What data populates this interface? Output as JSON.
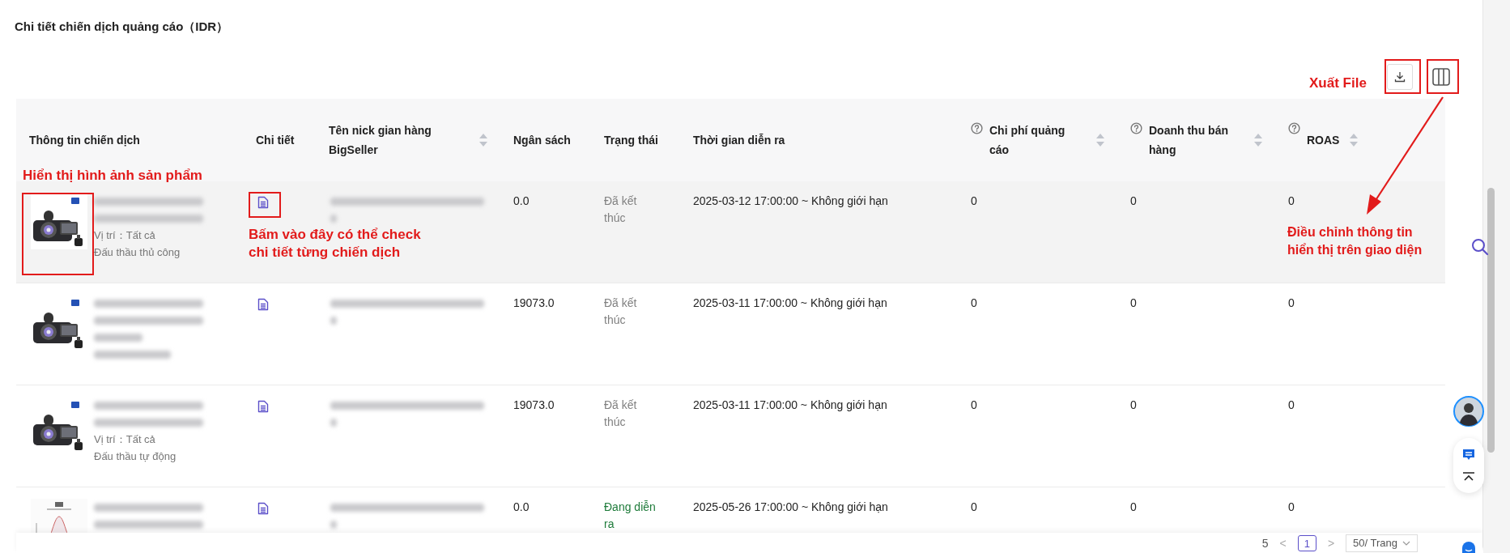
{
  "title": "Chi tiết chiến dịch quảng cáo（IDR）",
  "columns": [
    {
      "label": "Thông tin chiến dịch",
      "sortable": false,
      "help": false
    },
    {
      "label": "Chi tiết",
      "sortable": false,
      "help": false
    },
    {
      "label": "Tên nick gian hàng BigSeller",
      "sortable": true,
      "help": false
    },
    {
      "label": "Ngân sách",
      "sortable": false,
      "help": false
    },
    {
      "label": "Trạng thái",
      "sortable": false,
      "help": false
    },
    {
      "label": "Thời gian diễn ra",
      "sortable": false,
      "help": false
    },
    {
      "label": "Chi phí quảng cáo",
      "sortable": true,
      "help": true
    },
    {
      "label": "Doanh thu bán hàng",
      "sortable": true,
      "help": true
    },
    {
      "label": "ROAS",
      "sortable": true,
      "help": true
    }
  ],
  "rows": [
    {
      "highlighted": true,
      "campaign_lines": [
        {
          "kind": "blurred"
        },
        {
          "kind": "blurred"
        },
        {
          "kind": "text",
          "text": "Vị trí：Tất cả"
        },
        {
          "kind": "text",
          "text": "Đấu thầu thủ công"
        }
      ],
      "shop_lines": [
        {
          "kind": "blurred"
        },
        {
          "kind": "blurred"
        }
      ],
      "budget": "0.0",
      "status": {
        "kind": "ended",
        "text": "Đã kết thúc"
      },
      "period": "2025-03-12 17:00:00 ~ Không giới hạn",
      "cost": "0",
      "revenue": "0",
      "roas": "0"
    },
    {
      "highlighted": false,
      "campaign_lines": [
        {
          "kind": "blurred"
        },
        {
          "kind": "blurred"
        },
        {
          "kind": "blurred"
        },
        {
          "kind": "blurred"
        }
      ],
      "shop_lines": [
        {
          "kind": "blurred"
        },
        {
          "kind": "blurred"
        }
      ],
      "budget": "19073.0",
      "status": {
        "kind": "ended",
        "text": "Đã kết thúc"
      },
      "period": "2025-03-11 17:00:00 ~ Không giới hạn",
      "cost": "0",
      "revenue": "0",
      "roas": "0"
    },
    {
      "highlighted": false,
      "campaign_lines": [
        {
          "kind": "blurred"
        },
        {
          "kind": "blurred"
        },
        {
          "kind": "text",
          "text": "Vị trí：Tất cả"
        },
        {
          "kind": "text",
          "text": "Đấu thầu tự động"
        }
      ],
      "shop_lines": [
        {
          "kind": "blurred"
        },
        {
          "kind": "blurred"
        }
      ],
      "budget": "19073.0",
      "status": {
        "kind": "ended",
        "text": "Đã kết thúc"
      },
      "period": "2025-03-11 17:00:00 ~ Không giới hạn",
      "cost": "0",
      "revenue": "0",
      "roas": "0"
    },
    {
      "highlighted": false,
      "campaign_lines": [
        {
          "kind": "blurred"
        },
        {
          "kind": "blurred"
        }
      ],
      "shop_lines": [
        {
          "kind": "blurred"
        },
        {
          "kind": "blurred"
        }
      ],
      "budget": "0.0",
      "status": {
        "kind": "running",
        "text": "Đang diễn ra"
      },
      "period": "2025-05-26 17:00:00 ~ Không giới hạn",
      "cost": "0",
      "revenue": "0",
      "roas": "0"
    }
  ],
  "pagination": {
    "total": "5",
    "prev": "<",
    "pages": [
      {
        "label": "1",
        "selected": true
      }
    ],
    "next": ">",
    "page_size": "50/ Trang"
  },
  "annotations": [
    {
      "kind": "label",
      "text": "Hiển thị hình ảnh sản phẩm"
    },
    {
      "kind": "label",
      "text": "Bấm vào đây có thể check chi tiết từng chiến dịch"
    },
    {
      "kind": "label",
      "text": "Xuất File"
    },
    {
      "kind": "label",
      "text": "Điều chỉnh thông tin hiển thị trên giao diện"
    }
  ]
}
